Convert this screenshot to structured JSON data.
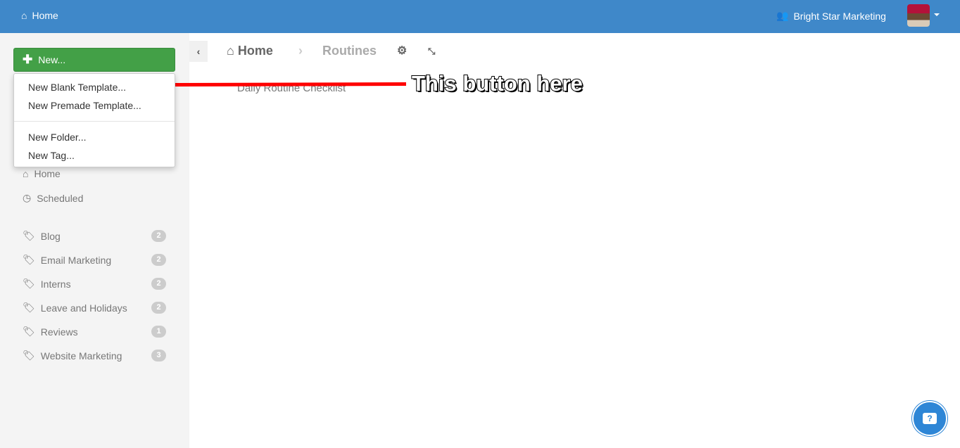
{
  "topbar": {
    "home": "Home",
    "org": "Bright Star Marketing"
  },
  "new_button": "New...",
  "new_menu": [
    "New Blank Template...",
    "New Premade Template...",
    "New Folder...",
    "New Tag..."
  ],
  "nav": [
    {
      "label": "Home",
      "icon": "home-icon"
    },
    {
      "label": "Scheduled",
      "icon": "clock-icon"
    }
  ],
  "tags": [
    {
      "label": "Blog",
      "count": "2"
    },
    {
      "label": "Email Marketing",
      "count": "2"
    },
    {
      "label": "Interns",
      "count": "2"
    },
    {
      "label": "Leave and Holidays",
      "count": "2"
    },
    {
      "label": "Reviews",
      "count": "1"
    },
    {
      "label": "Website Marketing",
      "count": "3"
    }
  ],
  "breadcrumb": {
    "home": "Home",
    "current": "Routines"
  },
  "items": [
    "Daily Routine Checklist"
  ],
  "annotation": "This button here",
  "help": "?",
  "colors": {
    "topbar": "#3f88c9",
    "new_button": "#43a047",
    "arrow": "#ff0000"
  }
}
